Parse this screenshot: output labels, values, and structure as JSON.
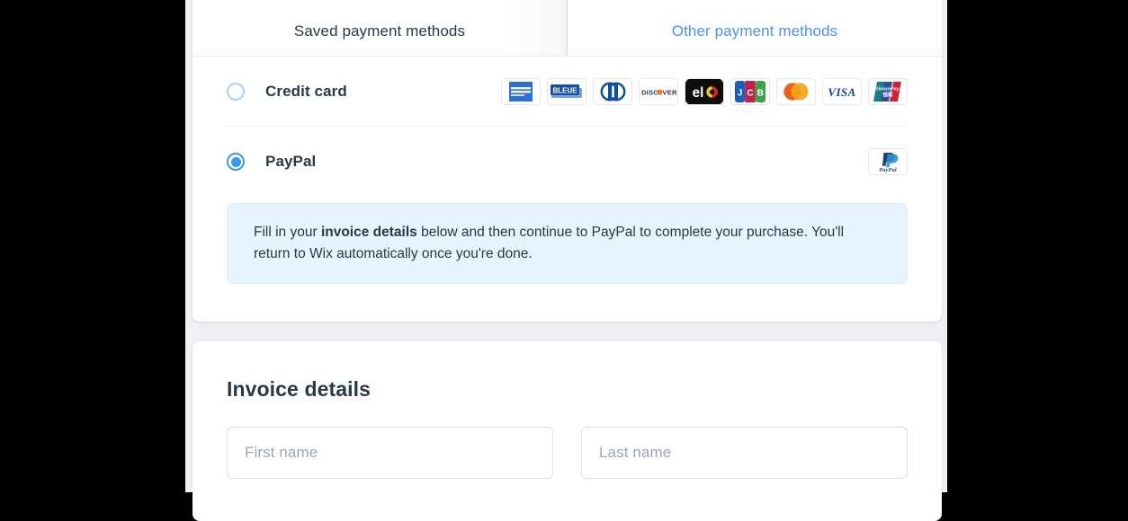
{
  "tabs": [
    {
      "id": "saved",
      "label": "Saved payment methods",
      "active": true
    },
    {
      "id": "other",
      "label": "Other payment methods",
      "active": false
    }
  ],
  "payment_methods": [
    {
      "id": "credit-card",
      "label": "Credit card",
      "selected": false,
      "brands": [
        "amex-icon",
        "cartebleue-icon",
        "dinersclub-icon",
        "discover-icon",
        "elo-icon",
        "jcb-icon",
        "mastercard-icon",
        "visa-icon",
        "unionpay-icon"
      ]
    },
    {
      "id": "paypal",
      "label": "PayPal",
      "selected": true,
      "brands": [
        "paypal-icon"
      ]
    }
  ],
  "notice": {
    "prefix": "Fill in your ",
    "bold": "invoice details",
    "suffix": " below and then continue to PayPal to complete your purchase. You'll return to Wix automatically once you're done."
  },
  "invoice": {
    "title": "Invoice details",
    "fields": [
      {
        "id": "first-name",
        "placeholder": "First name",
        "value": ""
      },
      {
        "id": "last-name",
        "placeholder": "Last name",
        "value": ""
      }
    ]
  },
  "colors": {
    "accent": "#3899ec",
    "link": "#4a90f7",
    "text": "#2b3947",
    "notice_bg": "#e7f3fe",
    "page_bg": "#eef0f4",
    "card_bg": "#ffffff",
    "field_border": "#cfe3f8",
    "placeholder": "#9aa6b4"
  }
}
